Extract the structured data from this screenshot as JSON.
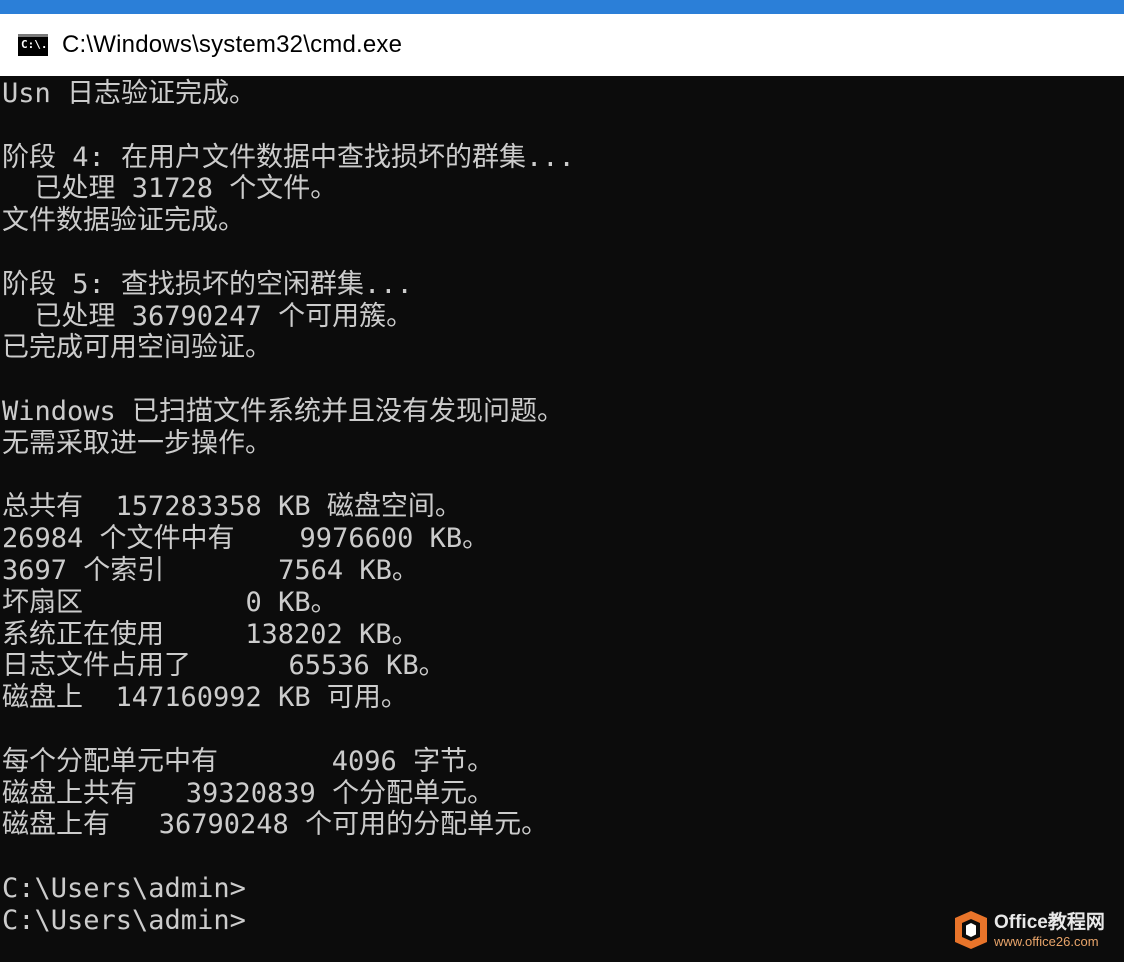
{
  "window": {
    "title": "C:\\Windows\\system32\\cmd.exe",
    "icon": "cmd-icon",
    "icon_glyph": "C:\\.",
    "accent_color": "#2b7fd8"
  },
  "console": {
    "text_color": "#cccccc",
    "background": "#0c0c0c",
    "lines": [
      "Usn 日志验证完成。",
      "",
      "阶段 4: 在用户文件数据中查找损坏的群集...",
      "  已处理 31728 个文件。",
      "文件数据验证完成。",
      "",
      "阶段 5: 查找损坏的空闲群集...",
      "  已处理 36790247 个可用簇。",
      "已完成可用空间验证。",
      "",
      "Windows 已扫描文件系统并且没有发现问题。",
      "无需采取进一步操作。",
      "",
      "总共有  157283358 KB 磁盘空间。",
      "26984 个文件中有    9976600 KB。",
      "3697 个索引       7564 KB。",
      "坏扇区          0 KB。",
      "系统正在使用     138202 KB。",
      "日志文件占用了      65536 KB。",
      "磁盘上  147160992 KB 可用。",
      "",
      "每个分配单元中有       4096 字节。",
      "磁盘上共有   39320839 个分配单元。",
      "磁盘上有   36790248 个可用的分配单元。",
      "",
      "C:\\Users\\admin>",
      "C:\\Users\\admin>"
    ]
  },
  "watermark": {
    "title": "Office教程网",
    "url": "www.office26.com",
    "logo": "office-logo-icon"
  }
}
